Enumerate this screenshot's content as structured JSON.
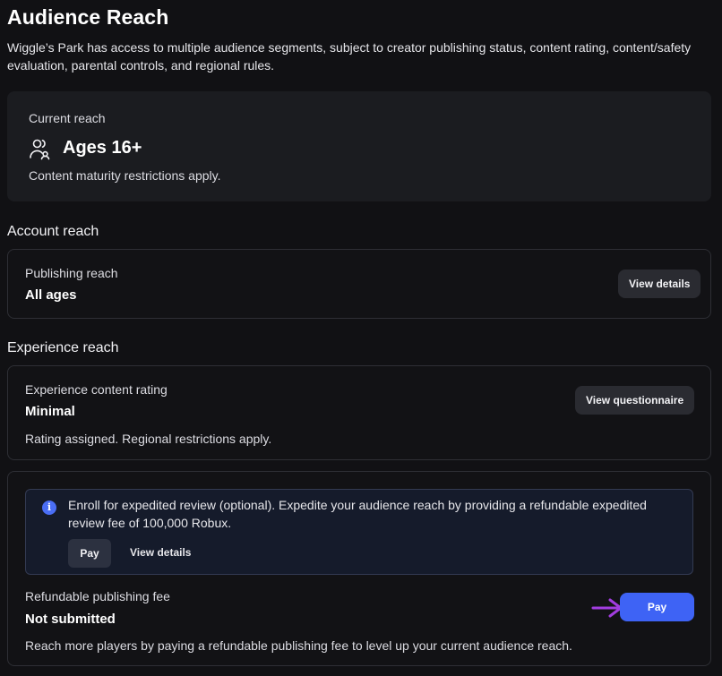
{
  "header": {
    "title": "Audience Reach",
    "description": "Wiggle’s Park has access to multiple audience segments, subject to creator publishing status, content rating, content/safety evaluation, parental controls, and regional rules."
  },
  "current_reach": {
    "label": "Current reach",
    "value": "Ages 16+",
    "note": "Content maturity restrictions apply.",
    "icon": "users-icon"
  },
  "account_reach": {
    "heading": "Account reach",
    "label": "Publishing reach",
    "value": "All ages",
    "button": "View details"
  },
  "experience_reach": {
    "heading": "Experience reach",
    "label": "Experience content rating",
    "value": "Minimal",
    "note": "Rating assigned. Regional restrictions apply.",
    "button": "View questionnaire"
  },
  "expedited_review": {
    "icon": "info-icon",
    "text": "Enroll for expedited review (optional). Expedite your audience reach by providing a refundable expedited review fee of 100,000 Robux.",
    "pay_button": "Pay",
    "details_link": "View details"
  },
  "publishing_fee": {
    "label": "Refundable publishing fee",
    "status": "Not submitted",
    "note": "Reach more players by paying a refundable publishing fee to level up your current audience reach.",
    "pay_button": "Pay"
  },
  "colors": {
    "background": "#111114",
    "card": "#1b1c20",
    "accent": "#3e63f5",
    "info_background": "#151b2b",
    "pointer_arrow": "#a23de0"
  }
}
